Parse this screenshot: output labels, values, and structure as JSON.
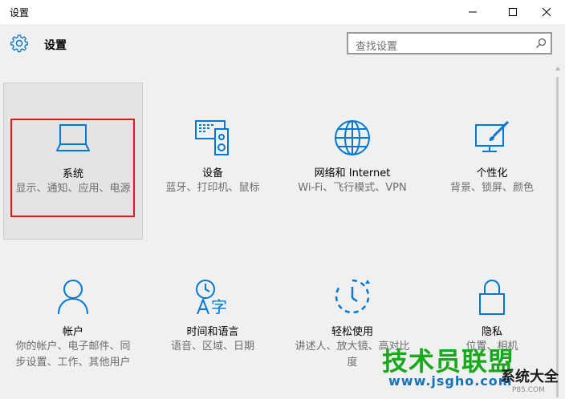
{
  "window": {
    "title": "设置",
    "controls": [
      "minimize",
      "maximize",
      "close"
    ]
  },
  "header": {
    "icon": "gear-icon",
    "title": "设置",
    "search_placeholder": "查找设置"
  },
  "accent_color": "#0078d7",
  "highlight_color": "#e31818",
  "tiles": [
    {
      "label": "系统",
      "desc": "显示、通知、应用、电源",
      "icon": "laptop-icon"
    },
    {
      "label": "设备",
      "desc": "蓝牙、打印机、鼠标",
      "icon": "devices-icon"
    },
    {
      "label": "网络和 Internet",
      "desc": "Wi-Fi、飞行模式、VPN",
      "icon": "globe-icon"
    },
    {
      "label": "个性化",
      "desc": "背景、锁屏、颜色",
      "icon": "personalize-icon"
    },
    {
      "label": "帐户",
      "desc": "你的帐户、电子邮件、同步设置、工作、其他用户",
      "icon": "person-icon"
    },
    {
      "label": "时间和语言",
      "desc": "语音、区域、日期",
      "icon": "time-language-icon"
    },
    {
      "label": "轻松使用",
      "desc": "讲述人、放大镜、高对比度",
      "icon": "ease-of-access-icon"
    },
    {
      "label": "隐私",
      "desc": "位置、相机",
      "icon": "lock-icon"
    }
  ],
  "watermark": {
    "main": "技术员联盟",
    "url": "www.jsgho.com",
    "small": "系统大全",
    "tiny": "P85.COM"
  }
}
